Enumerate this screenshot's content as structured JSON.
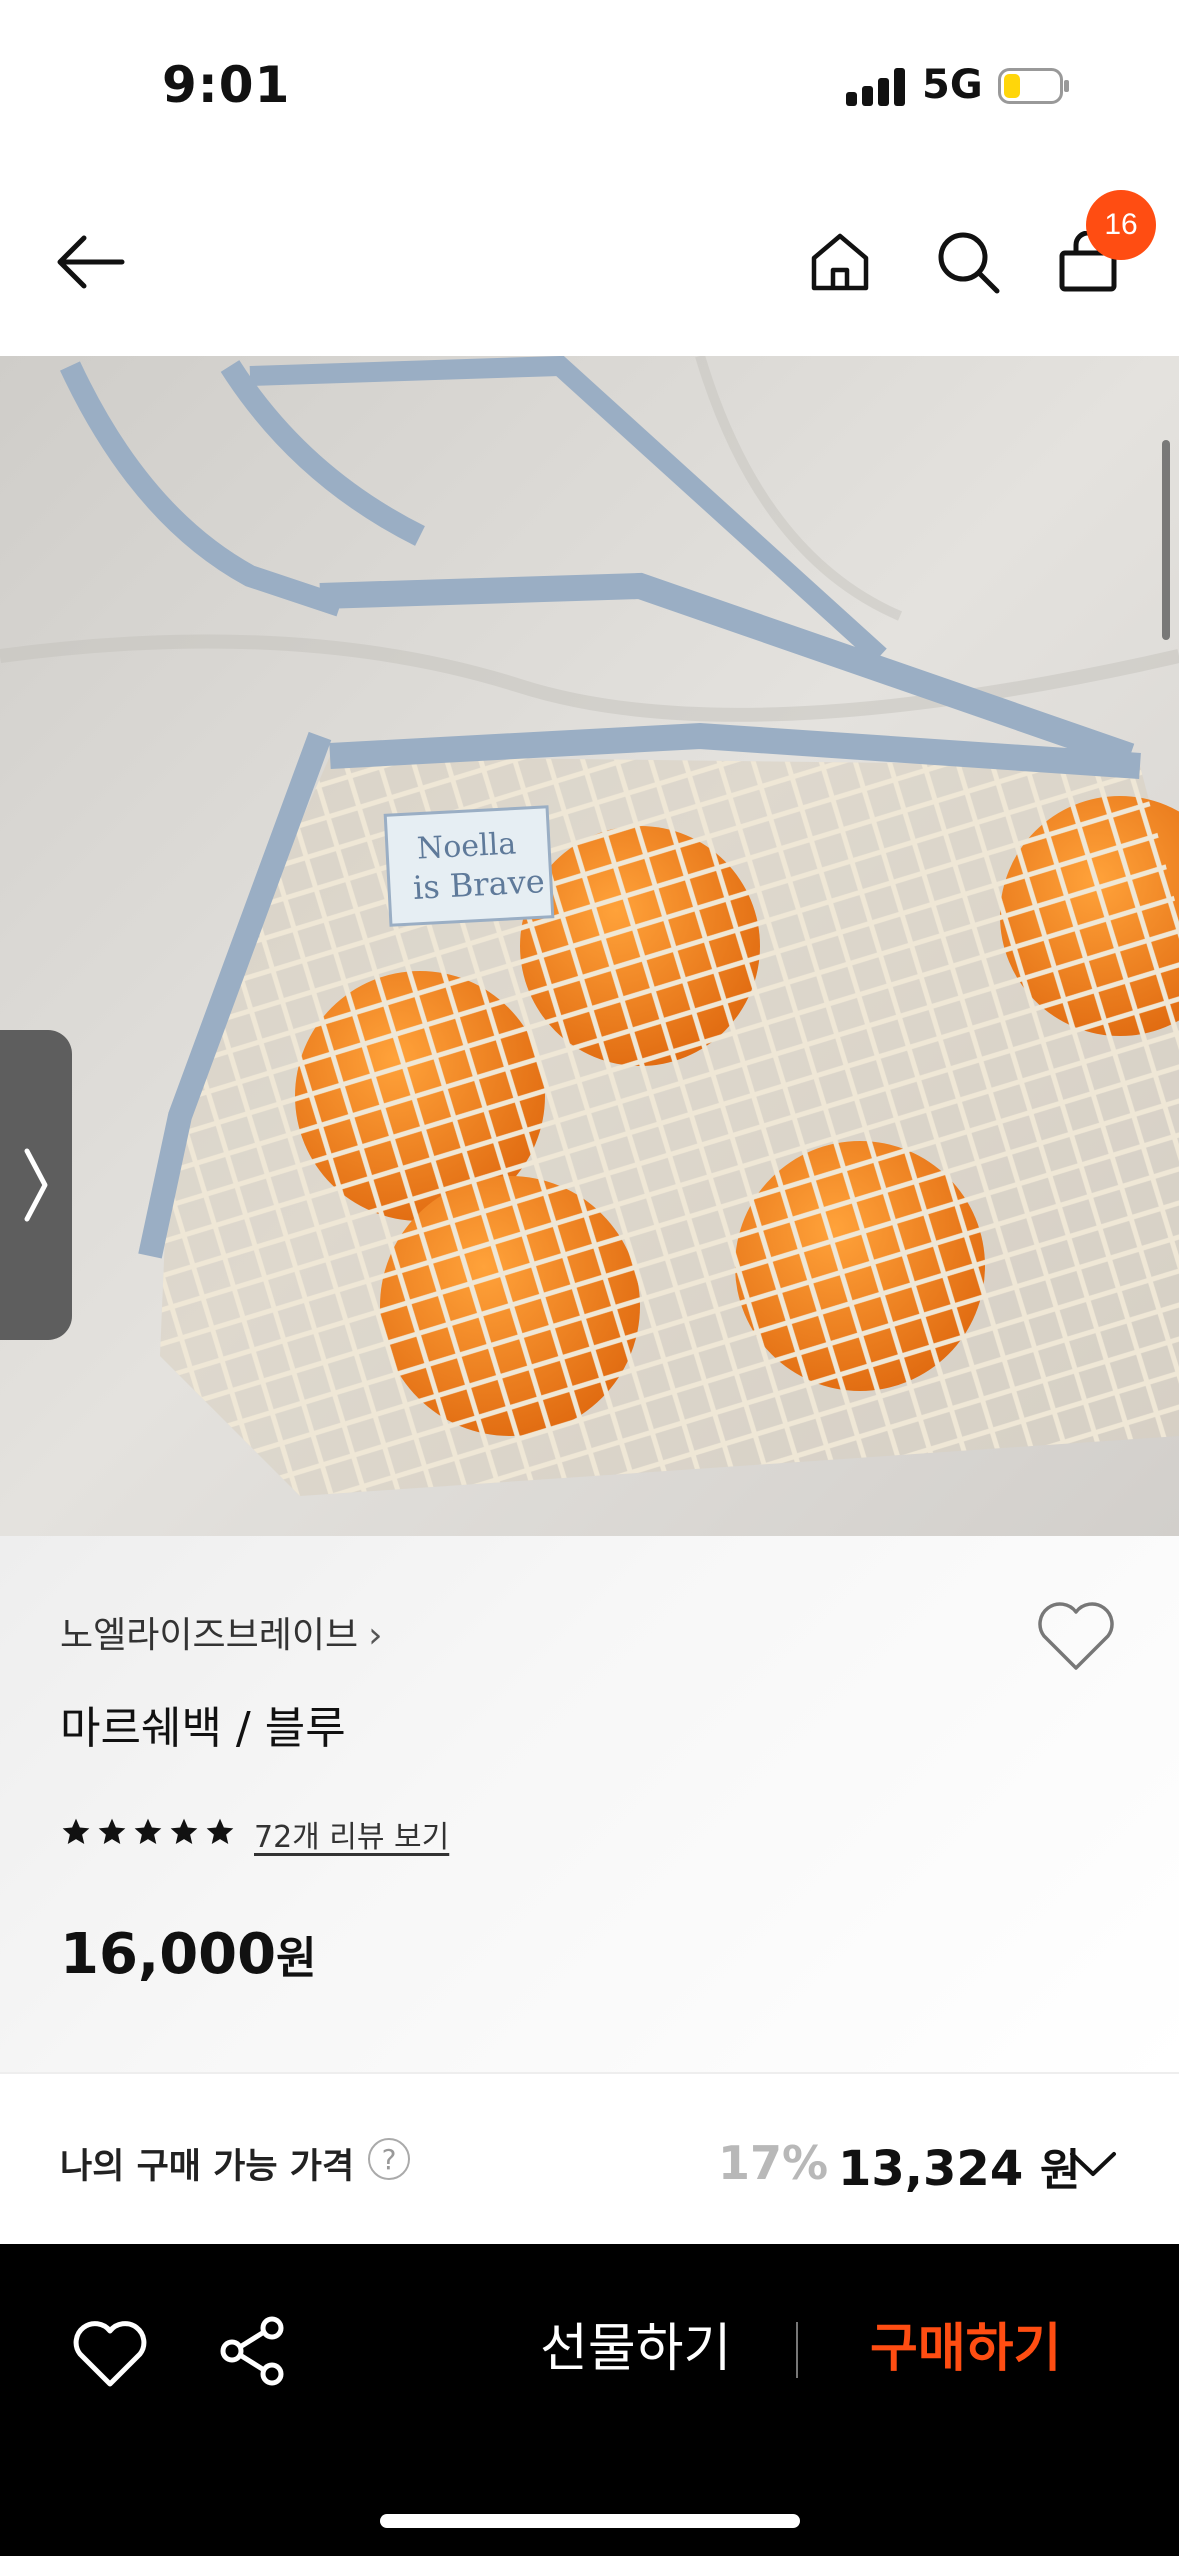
{
  "status_bar": {
    "time": "9:01",
    "network": "5G"
  },
  "nav": {
    "cart_count": "16"
  },
  "product": {
    "brand": "노엘라이즈브레이브",
    "title": "마르쉐백 / 블루",
    "rating_stars": 5,
    "reviews_label": "72개 리뷰 보기",
    "price_value": "16,000",
    "price_unit": "원",
    "image_tag_line1": "Noella",
    "image_tag_line2": "is Brave"
  },
  "my_price": {
    "label": "나의 구매 가능 가격",
    "help": "?",
    "discount": "17%",
    "value": "13,324",
    "unit": "원"
  },
  "bottom_bar": {
    "gift_label": "선물하기",
    "buy_label": "구매하기"
  },
  "colors": {
    "accent": "#ff4d12",
    "badge": "#ff4d12",
    "bottom_bar_bg": "#000000"
  }
}
